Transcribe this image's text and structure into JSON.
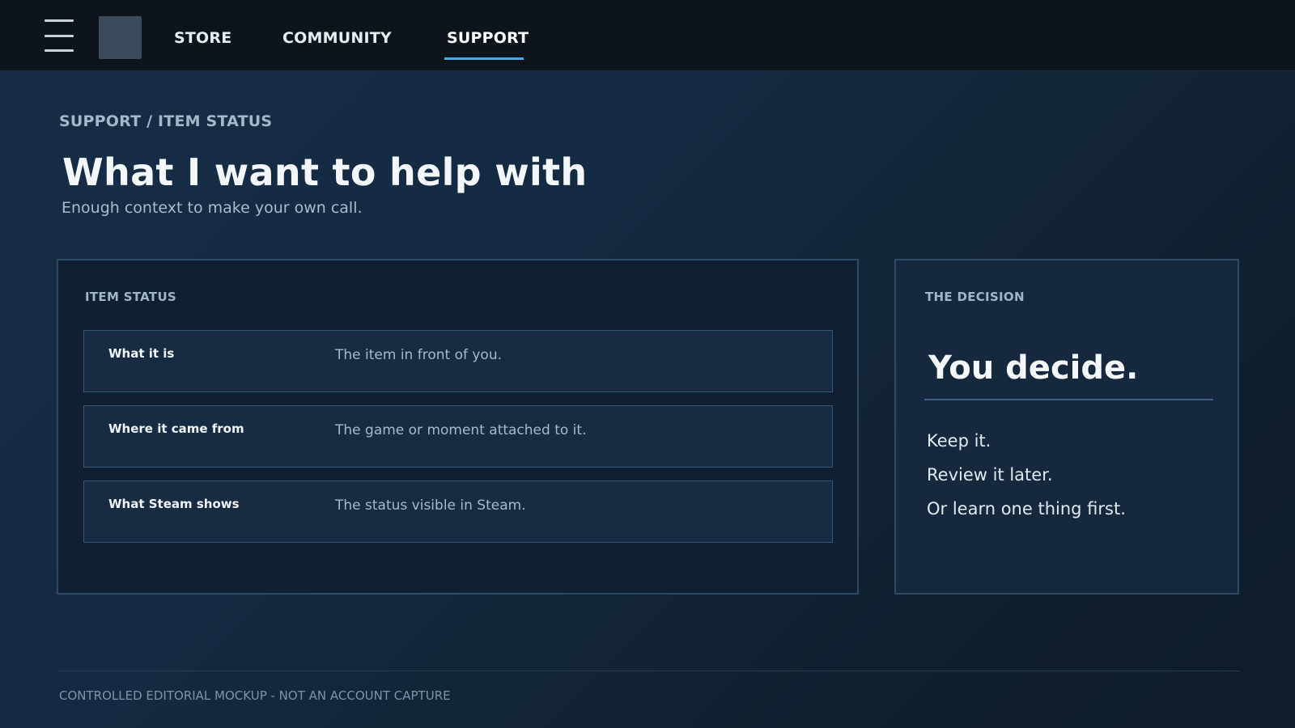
{
  "nav": {
    "menu_icon": "hamburger-menu-icon",
    "logo_icon": "app-logo-placeholder",
    "items": [
      {
        "label": "STORE"
      },
      {
        "label": "COMMUNITY"
      },
      {
        "label": "SUPPORT",
        "active": true
      }
    ],
    "accent_color": "#4ea8e6"
  },
  "breadcrumb": "SUPPORT / ITEM STATUS",
  "page": {
    "title": "What I want to help with",
    "subtitle": "Enough context to make your own call."
  },
  "item_status": {
    "label": "ITEM STATUS",
    "rows": [
      {
        "key": "What it is",
        "value": "The item in front of you."
      },
      {
        "key": "Where it came from",
        "value": "The game or moment attached to it."
      },
      {
        "key": "What Steam shows",
        "value": "The status visible in Steam."
      }
    ]
  },
  "decision": {
    "label": "THE DECISION",
    "heading": "You decide.",
    "lines": [
      "Keep it.",
      "Review it later.",
      "Or learn one thing first."
    ]
  },
  "footer": {
    "text": "CONTROLLED EDITORIAL MOCKUP - NOT AN ACCOUNT CAPTURE"
  }
}
